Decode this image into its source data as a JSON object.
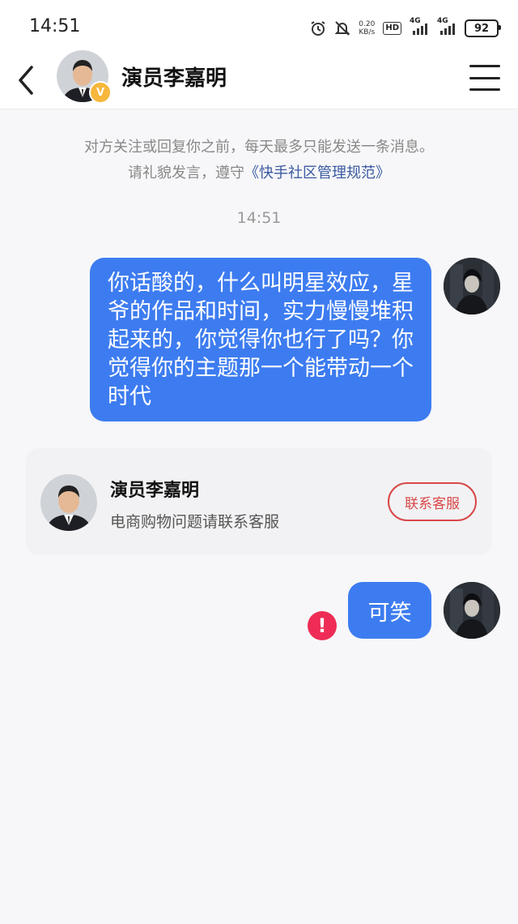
{
  "status_bar": {
    "time": "14:51",
    "net_speed_value": "0.20",
    "net_speed_unit": "KB/s",
    "hd_label": "HD",
    "sim1_label": "4G",
    "sim2_label": "4G",
    "battery": "92",
    "icons": [
      "alarm-icon",
      "mute-icon",
      "hd-icon",
      "signal-icon",
      "signal-icon",
      "battery-icon"
    ]
  },
  "header": {
    "title": "演员李嘉明",
    "verified_badge": "V"
  },
  "notice": {
    "line1": "对方关注或回复你之前，每天最多只能发送一条消息。",
    "line2_prefix": "请礼貌发言，遵守",
    "line2_link": "《快手社区管理规范》"
  },
  "timestamp": "14:51",
  "messages": [
    {
      "sender": "self",
      "text": "你话酸的，什么叫明星效应，星爷的作品和时间，实力慢慢堆积起来的，你觉得你也行了吗？你觉得你的主题那一个能带动一个时代"
    },
    {
      "sender": "self",
      "text": "可笑",
      "status": "failed"
    }
  ],
  "card": {
    "name": "演员李嘉明",
    "description": "电商购物问题请联系客服",
    "button_label": "联系客服"
  },
  "colors": {
    "bubble": "#3d7cf0",
    "link": "#3a5aa0",
    "error": "#ee2c55",
    "contact_button": "#d84747",
    "verified": "#f6b73c"
  }
}
